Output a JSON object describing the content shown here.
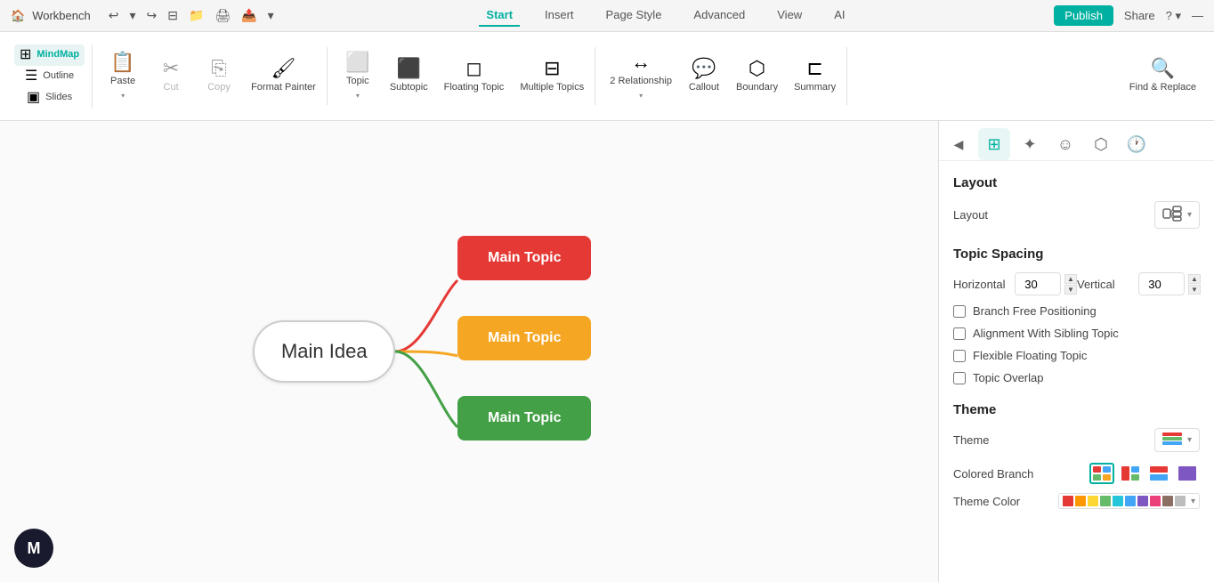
{
  "titlebar": {
    "app_name": "Workbench",
    "undo_label": "Undo",
    "redo_label": "Redo",
    "tabs": [
      {
        "id": "start",
        "label": "Start",
        "active": true
      },
      {
        "id": "insert",
        "label": "Insert"
      },
      {
        "id": "page_style",
        "label": "Page Style"
      },
      {
        "id": "advanced",
        "label": "Advanced"
      },
      {
        "id": "view",
        "label": "View"
      },
      {
        "id": "ai",
        "label": "AI"
      }
    ],
    "publish_label": "Publish",
    "share_label": "Share",
    "help_label": "?"
  },
  "toolbar": {
    "view_items": [
      {
        "id": "mindmap",
        "label": "MindMap",
        "icon": "⊞"
      },
      {
        "id": "outline",
        "label": "Outline",
        "icon": "☰"
      },
      {
        "id": "slides",
        "label": "Slides",
        "icon": "▣"
      }
    ],
    "items": [
      {
        "id": "paste",
        "label": "Paste",
        "icon": "📋",
        "has_arrow": true,
        "disabled": false
      },
      {
        "id": "cut",
        "label": "Cut",
        "icon": "✂",
        "has_arrow": false,
        "disabled": true
      },
      {
        "id": "copy",
        "label": "Copy",
        "icon": "⎘",
        "has_arrow": false,
        "disabled": true
      },
      {
        "id": "format_painter",
        "label": "Format Painter",
        "icon": "🖌",
        "has_arrow": false,
        "disabled": false
      },
      {
        "id": "topic",
        "label": "Topic",
        "icon": "⬜",
        "has_arrow": true,
        "disabled": false
      },
      {
        "id": "subtopic",
        "label": "Subtopic",
        "icon": "⬛",
        "has_arrow": false,
        "disabled": false
      },
      {
        "id": "floating_topic",
        "label": "Floating Topic",
        "icon": "◻",
        "has_arrow": false,
        "disabled": false
      },
      {
        "id": "multiple_topics",
        "label": "Multiple Topics",
        "icon": "⊟",
        "has_arrow": false,
        "disabled": false
      },
      {
        "id": "relationship",
        "label": "2 Relationship",
        "icon": "↔",
        "has_arrow": true,
        "disabled": false
      },
      {
        "id": "callout",
        "label": "Callout",
        "icon": "💬",
        "has_arrow": false,
        "disabled": false
      },
      {
        "id": "boundary",
        "label": "Boundary",
        "icon": "⬡",
        "has_arrow": false,
        "disabled": false
      },
      {
        "id": "summary",
        "label": "Summary",
        "icon": "⊏",
        "has_arrow": false,
        "disabled": false
      },
      {
        "id": "find_replace",
        "label": "Find & Replace",
        "icon": "🔍",
        "has_arrow": false,
        "disabled": false
      }
    ]
  },
  "canvas": {
    "central_node_text": "Main Idea",
    "topics": [
      {
        "id": "topic1",
        "label": "Main Topic",
        "color": "#e53935"
      },
      {
        "id": "topic2",
        "label": "Main Topic",
        "color": "#f5a623"
      },
      {
        "id": "topic3",
        "label": "Main Topic",
        "color": "#43a047"
      }
    ]
  },
  "right_panel": {
    "tabs": [
      {
        "id": "layout",
        "icon": "⊞",
        "active": true
      },
      {
        "id": "ai_star",
        "icon": "✦"
      },
      {
        "id": "emoji",
        "icon": "☺"
      },
      {
        "id": "shapes",
        "icon": "⬡"
      },
      {
        "id": "clock",
        "icon": "🕐"
      }
    ],
    "layout_section": {
      "title": "Layout",
      "layout_label": "Layout",
      "layout_icon": "⊞"
    },
    "spacing_section": {
      "title": "Topic Spacing",
      "horizontal_label": "Horizontal",
      "horizontal_value": "30",
      "vertical_label": "Vertical",
      "vertical_value": "30"
    },
    "checkboxes": [
      {
        "id": "branch_free",
        "label": "Branch Free Positioning",
        "checked": false
      },
      {
        "id": "alignment_sibling",
        "label": "Alignment With Sibling Topic",
        "checked": false
      },
      {
        "id": "flexible_floating",
        "label": "Flexible Floating Topic",
        "checked": false
      },
      {
        "id": "topic_overlap",
        "label": "Topic Overlap",
        "checked": false
      }
    ],
    "theme_section": {
      "title": "Theme",
      "theme_label": "Theme"
    },
    "colored_branch": {
      "label": "Colored Branch"
    },
    "theme_color": {
      "label": "Theme Color",
      "colors": [
        "#e53935",
        "#ff9800",
        "#fdd835",
        "#66bb6a",
        "#26c6da",
        "#42a5f5",
        "#7e57c2",
        "#ec407a",
        "#8d6e63",
        "#bdbdbd"
      ]
    }
  }
}
